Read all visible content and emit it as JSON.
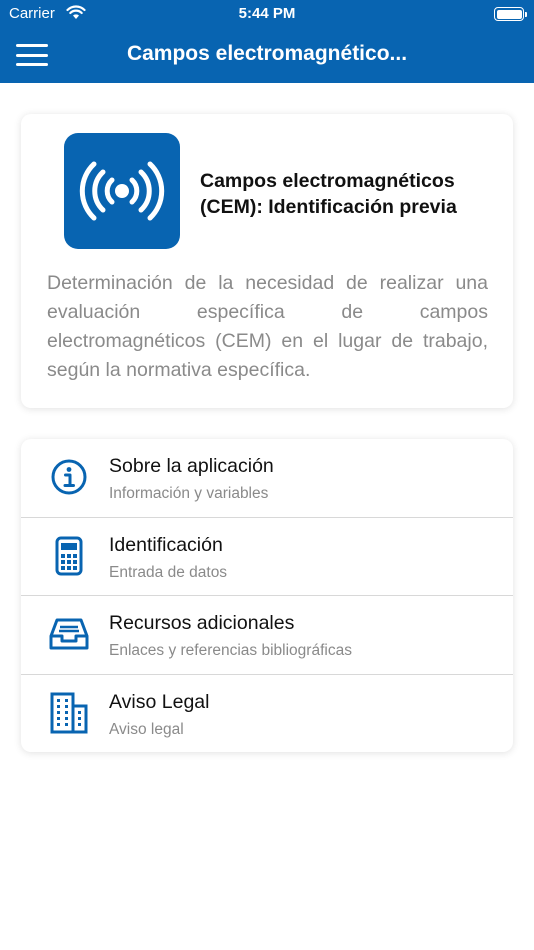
{
  "status_bar": {
    "carrier": "Carrier",
    "time": "5:44 PM",
    "wifi_icon": "wifi-icon",
    "battery_icon": "battery-icon"
  },
  "nav": {
    "title": "Campos electromagnético...",
    "menu_icon": "hamburger-menu-icon"
  },
  "colors": {
    "brand": "#0864b1",
    "background": "#ffffff",
    "text_primary": "#111111",
    "text_secondary": "#8a8a8a"
  },
  "app_card": {
    "icon": "broadcast-signal-icon",
    "title": "Campos electromagnéticos (CEM): Identificación previa",
    "description": "Determinación de la necesidad de realizar una evaluación específica de campos electromagnéticos (CEM) en el lugar de trabajo, según la normativa específica."
  },
  "menu": {
    "items": [
      {
        "icon": "info-circle-icon",
        "label": "Sobre la aplicación",
        "sub": "Información y variables"
      },
      {
        "icon": "calculator-icon",
        "label": "Identificación",
        "sub": "Entrada de datos"
      },
      {
        "icon": "inbox-tray-icon",
        "label": "Recursos adicionales",
        "sub": "Enlaces y referencias bibliográficas"
      },
      {
        "icon": "building-icon",
        "label": "Aviso Legal",
        "sub": "Aviso legal"
      }
    ]
  }
}
